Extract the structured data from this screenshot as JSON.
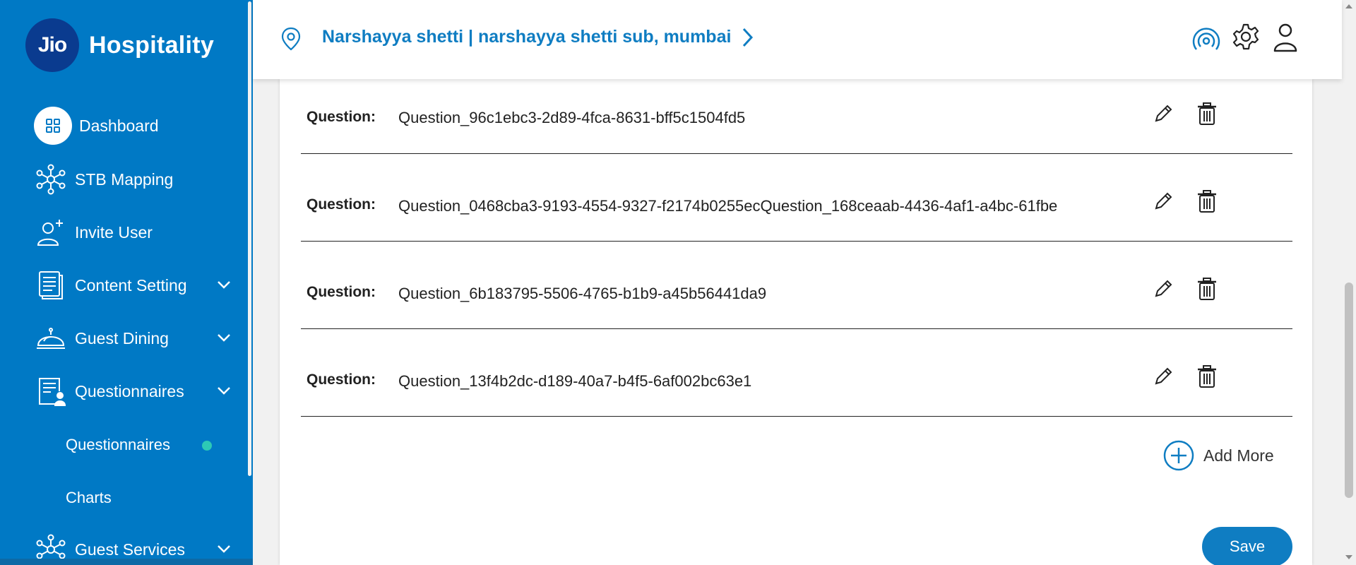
{
  "brand": {
    "logo_text": "Jio",
    "app_name": "Hospitality"
  },
  "sidebar": {
    "items": [
      {
        "label": "Dashboard",
        "icon": "dashboard-grid-icon"
      },
      {
        "label": "STB Mapping",
        "icon": "network-nodes-icon"
      },
      {
        "label": "Invite User",
        "icon": "add-user-icon"
      },
      {
        "label": "Content Setting",
        "icon": "document-icon",
        "expandable": true
      },
      {
        "label": "Guest Dining",
        "icon": "food-cloche-icon",
        "expandable": true
      },
      {
        "label": "Questionnaires",
        "icon": "questionnaire-user-icon",
        "expandable": true
      }
    ],
    "sub_items": [
      {
        "label": "Questionnaires",
        "active": true
      },
      {
        "label": "Charts"
      }
    ],
    "last_item": {
      "label": "Guest Services",
      "icon": "network-nodes-icon",
      "expandable": true
    }
  },
  "header": {
    "location": "Narshayya shetti | narshayya shetti sub, mumbai",
    "icons": [
      "broadcast-icon",
      "gear-icon",
      "user-profile-icon"
    ]
  },
  "questions": {
    "label": "Question:",
    "items": [
      "Question_96c1ebc3-2d89-4fca-8631-bff5c1504fd5",
      "Question_0468cba3-9193-4554-9327-f2174b0255ecQuestion_168ceaab-4436-4af1-a4bc-61fbe",
      "Question_6b183795-5506-4765-b1b9-a45b56441da9",
      "Question_13f4b2dc-d189-40a7-b4f5-6af002bc63e1"
    ]
  },
  "actions": {
    "add_more": "Add More",
    "save": "Save"
  },
  "colors": {
    "primary": "#0079c5",
    "accent": "#0f7dc2",
    "active_dot": "#2dc9b5",
    "logo_bg": "#0a3b8f"
  }
}
